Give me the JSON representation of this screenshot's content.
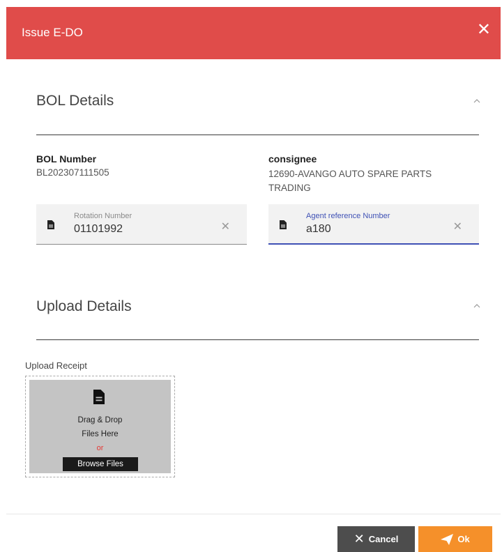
{
  "dialog": {
    "title": "Issue E-DO",
    "close_icon": "close-icon"
  },
  "bol_details": {
    "section_title": "BOL Details",
    "bol_number_label": "BOL Number",
    "bol_number_value": "BL202307111505",
    "consignee_label": "consignee",
    "consignee_value": "12690-AVANGO AUTO SPARE PARTS TRADING",
    "rotation_number": {
      "label": "Rotation Number",
      "value": "01101992",
      "icon": "document-icon"
    },
    "agent_reference": {
      "label": "Agent reference Number",
      "value": "a180",
      "icon": "document-icon"
    }
  },
  "upload_details": {
    "section_title": "Upload Details",
    "upload_label": "Upload Receipt",
    "drop_line1": "Drag & Drop",
    "drop_line2": "Files Here",
    "or_text": "or",
    "browse_label": "Browse Files"
  },
  "footer": {
    "cancel_label": "Cancel",
    "ok_label": "Ok"
  },
  "colors": {
    "header": "#e04c4a",
    "active_field": "#3f51b5",
    "ok_button": "#f5902a",
    "cancel_button": "#4d4d4d"
  }
}
